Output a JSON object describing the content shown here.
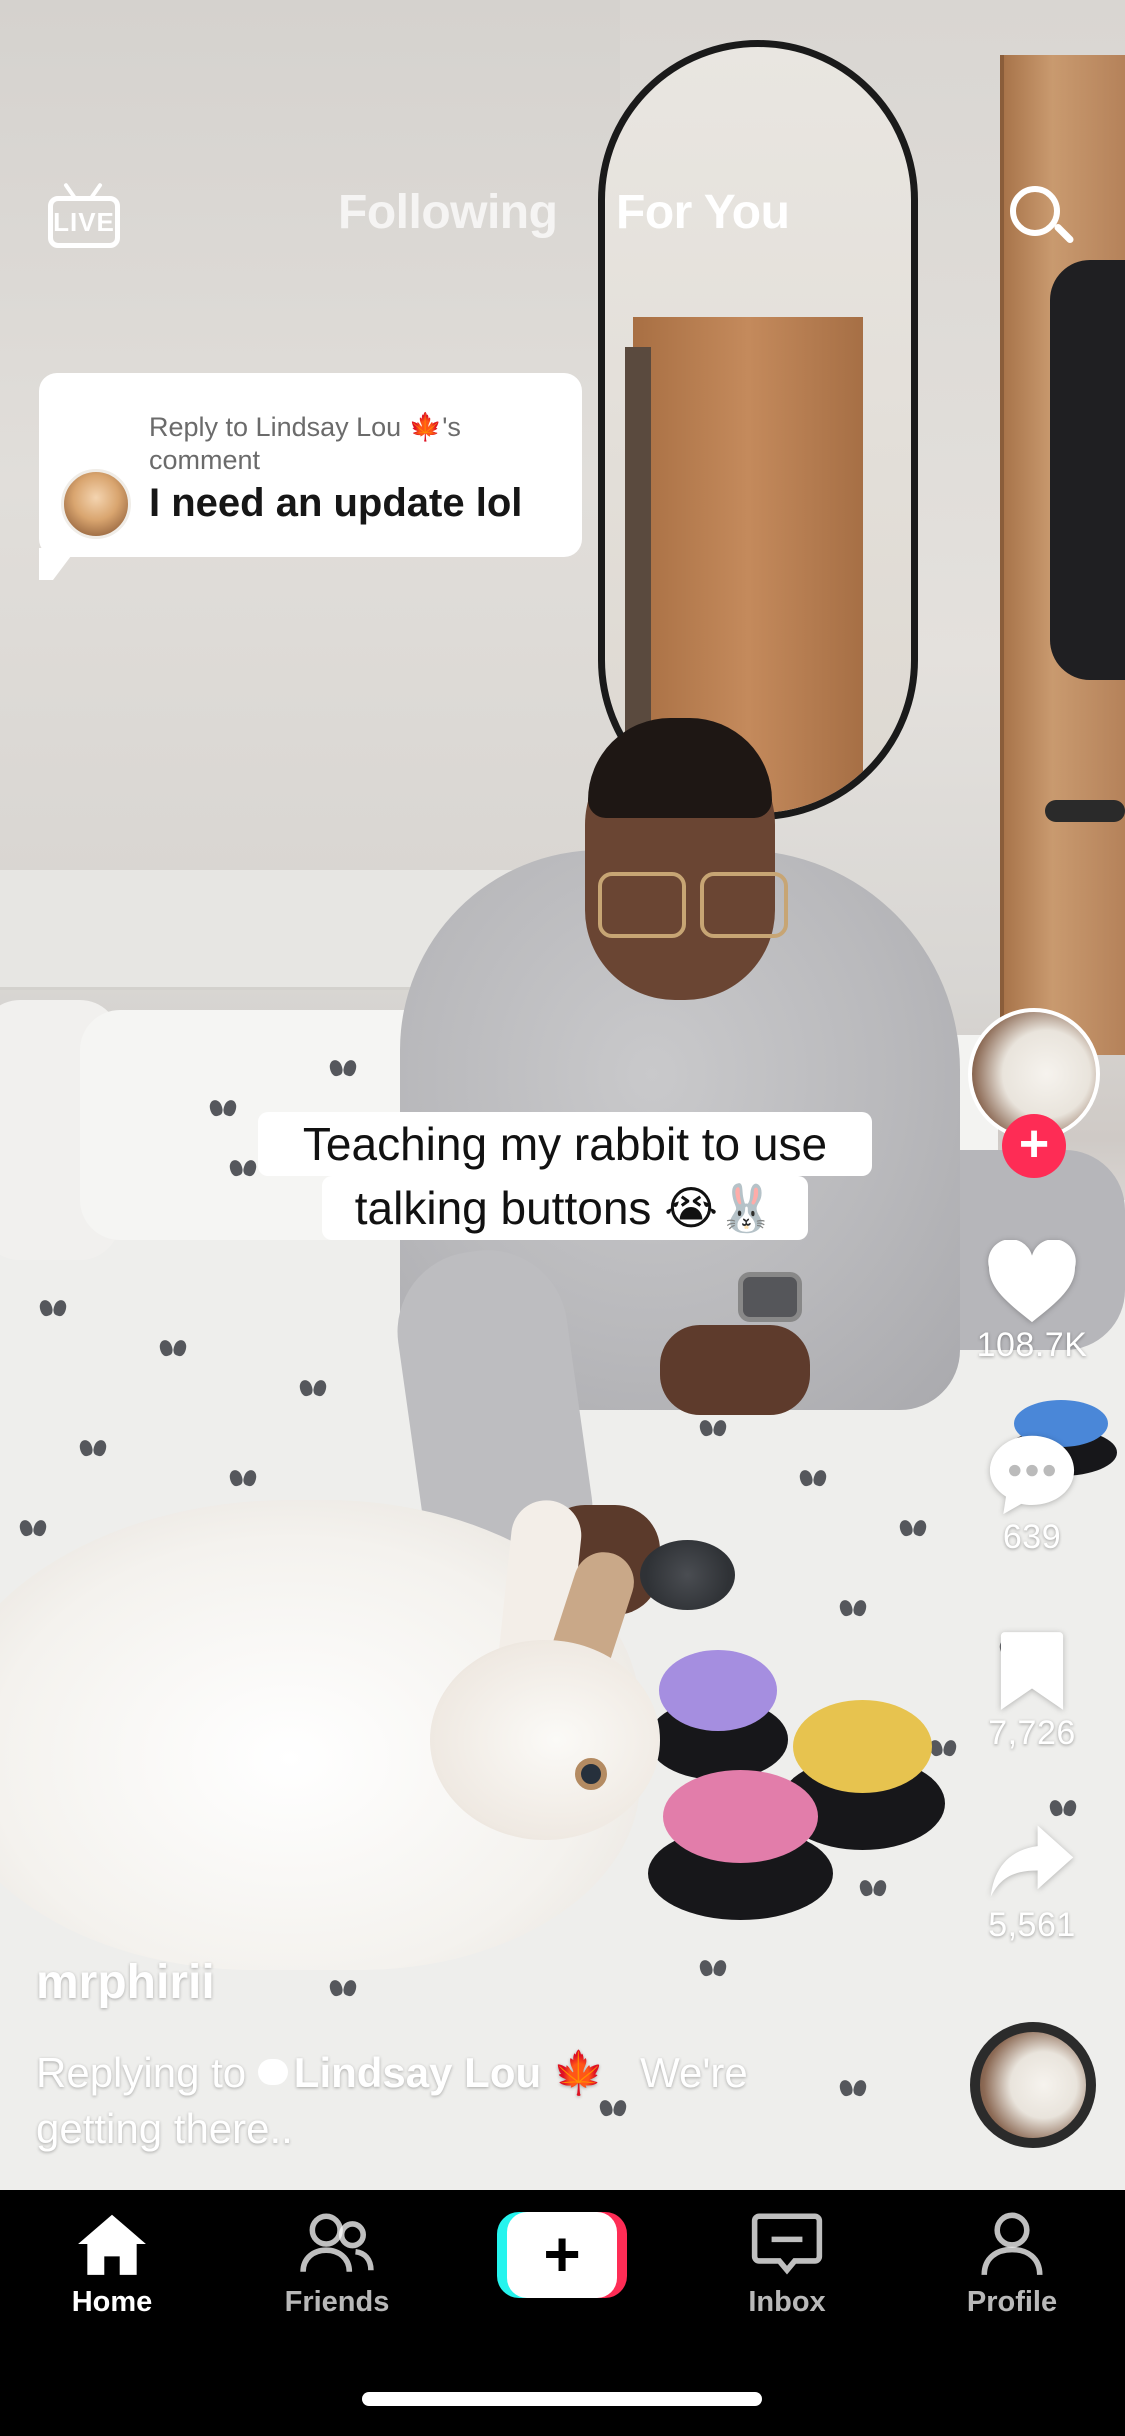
{
  "top_bar": {
    "live_label": "LIVE",
    "tabs": [
      {
        "label": "Following",
        "active": false
      },
      {
        "label": "For You",
        "active": true
      }
    ]
  },
  "reply_card": {
    "reply_to_text": "Reply to Lindsay Lou 🍁's comment",
    "comment_text": "I need an update lol"
  },
  "caption_overlay": {
    "line1": "Teaching my rabbit to use",
    "line2": "talking buttons 😭🐰"
  },
  "right_rail": {
    "likes": "108.7K",
    "comments": "639",
    "saves": "7,726",
    "shares": "5,561"
  },
  "post": {
    "author": "mrphirii",
    "replying_prefix": "Replying to",
    "replying_user": "Lindsay Lou 🍁",
    "description_line1_tail": "We're",
    "description_line2": "getting there.."
  },
  "bottom_nav": {
    "items": [
      {
        "label": "Home",
        "icon": "home-icon",
        "active": true
      },
      {
        "label": "Friends",
        "icon": "friends-icon",
        "active": false
      },
      {
        "label": "",
        "icon": "create-plus-icon",
        "active": false
      },
      {
        "label": "Inbox",
        "icon": "inbox-icon",
        "active": false
      },
      {
        "label": "Profile",
        "icon": "profile-icon",
        "active": false
      }
    ]
  },
  "colors": {
    "accent_red": "#fe2c55",
    "accent_cyan": "#25f4ee",
    "nav_background": "#000000"
  }
}
